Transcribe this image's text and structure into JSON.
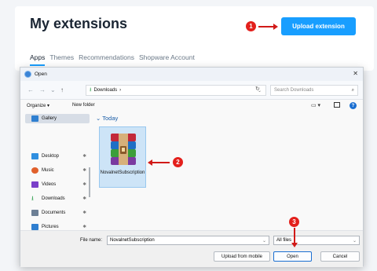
{
  "header": {
    "title": "My extensions",
    "upload_label": "Upload extension",
    "tabs": [
      "Apps",
      "Themes",
      "Recommendations",
      "Shopware Account"
    ]
  },
  "markers": [
    "1",
    "2",
    "3"
  ],
  "dialog": {
    "title": "Open",
    "path": [
      "Downloads",
      "›"
    ],
    "search_placeholder": "Search Downloads",
    "organize_label": "Organize ▾",
    "new_folder_label": "New folder",
    "sidebar": [
      {
        "label": "Gallery",
        "icon": "gallery-icon",
        "color": "#2f7fd0"
      },
      {
        "label": "Desktop",
        "icon": "desktop-icon",
        "color": "#2f8fe0"
      },
      {
        "label": "Music",
        "icon": "music-icon",
        "color": "#e0602c"
      },
      {
        "label": "Videos",
        "icon": "videos-icon",
        "color": "#7a3fc9"
      },
      {
        "label": "Downloads",
        "icon": "download-icon",
        "color": "#2a9d4a"
      },
      {
        "label": "Documents",
        "icon": "documents-icon",
        "color": "#6c7f95"
      },
      {
        "label": "Pictures",
        "icon": "pictures-icon",
        "color": "#2f7fd0"
      }
    ],
    "group_label": "Today",
    "file": {
      "name": "NovalnetSubscription",
      "icon": "winrar-archive-icon"
    },
    "file_name_label": "File name:",
    "file_name_value": "NovalnetSubscription",
    "file_type_value": "All files",
    "upload_mobile_label": "Upload from mobile",
    "open_label": "Open",
    "cancel_label": "Cancel"
  },
  "colors": {
    "accent": "#189eff",
    "marker": "#e3201c"
  }
}
